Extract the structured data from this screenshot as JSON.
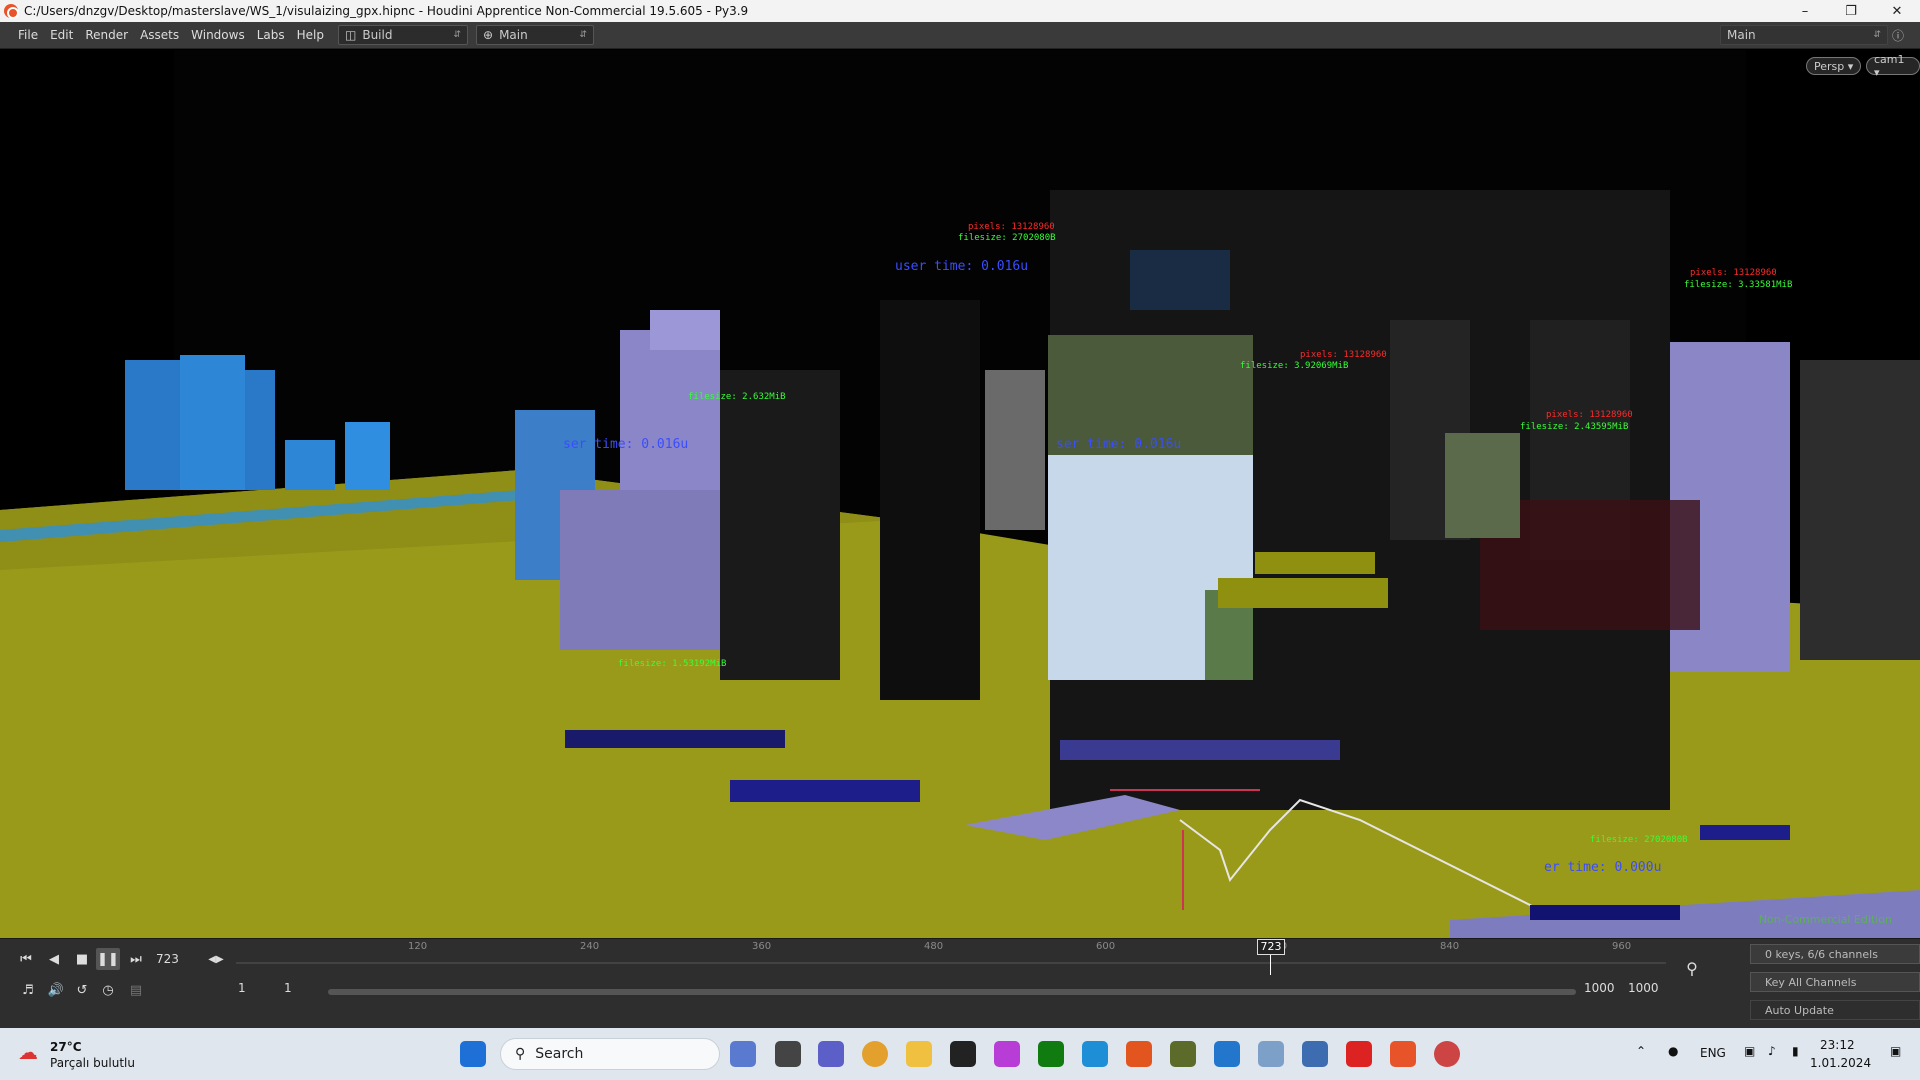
{
  "window": {
    "title": "C:/Users/dnzgv/Desktop/masterslave/WS_1/visulaizing_gpx.hipnc - Houdini Apprentice Non-Commercial 19.5.605 - Py3.9",
    "controls": [
      "–",
      "❐",
      "✕"
    ]
  },
  "menu": {
    "items": [
      "File",
      "Edit",
      "Render",
      "Assets",
      "Windows",
      "Labs",
      "Help"
    ],
    "desktop_label": "Build",
    "main_label": "Main",
    "right_label": "Main"
  },
  "viewport": {
    "persp_label": "Persp ▾",
    "cam_label": "cam1 ▾",
    "noncommercial": "Non-Commercial Edition",
    "overlays": [
      {
        "cls": "red",
        "text": "pixels: 13128960"
      },
      {
        "cls": "green",
        "text": "filesize: 2702080B"
      },
      {
        "cls": "blue",
        "text": "user time: 0.016u"
      },
      {
        "cls": "red",
        "text": "pixels: 13128960"
      },
      {
        "cls": "green",
        "text": "filesize: 3.33581MiB"
      },
      {
        "cls": "red",
        "text": "pixels: 13128960"
      },
      {
        "cls": "green",
        "text": "filesize: 3.92069MiB"
      },
      {
        "cls": "blue",
        "text": "ser time: 0.016u"
      },
      {
        "cls": "red",
        "text": "pixels: 13128960"
      },
      {
        "cls": "green",
        "text": "filesize: 2.43595MiB"
      },
      {
        "cls": "green",
        "text": "filesize: 1.53192MiB"
      },
      {
        "cls": "green",
        "text": "filesize: 2.632MiB"
      },
      {
        "cls": "blue",
        "text": "ser time: 0.016u"
      },
      {
        "cls": "green",
        "text": "filesize: 2702080B"
      },
      {
        "cls": "blue",
        "text": "er time: 0.000u"
      }
    ]
  },
  "timeline": {
    "current_frame": "723",
    "marker": "723",
    "ticks": [
      "120",
      "240",
      "360",
      "480",
      "600",
      "720",
      "840",
      "960"
    ],
    "range_start_a": "1",
    "range_start_b": "1",
    "range_end_a": "1000",
    "range_end_b": "1000",
    "keys_label": "0 keys, 6/6 channels",
    "key_all": "Key All Channels",
    "auto_update": "Auto Update"
  },
  "taskbar": {
    "weather_temp": "27°C",
    "weather_desc": "Parçalı bulutlu",
    "search": "Search",
    "lang": "ENG",
    "time": "23:12",
    "date": "1.01.2024"
  }
}
